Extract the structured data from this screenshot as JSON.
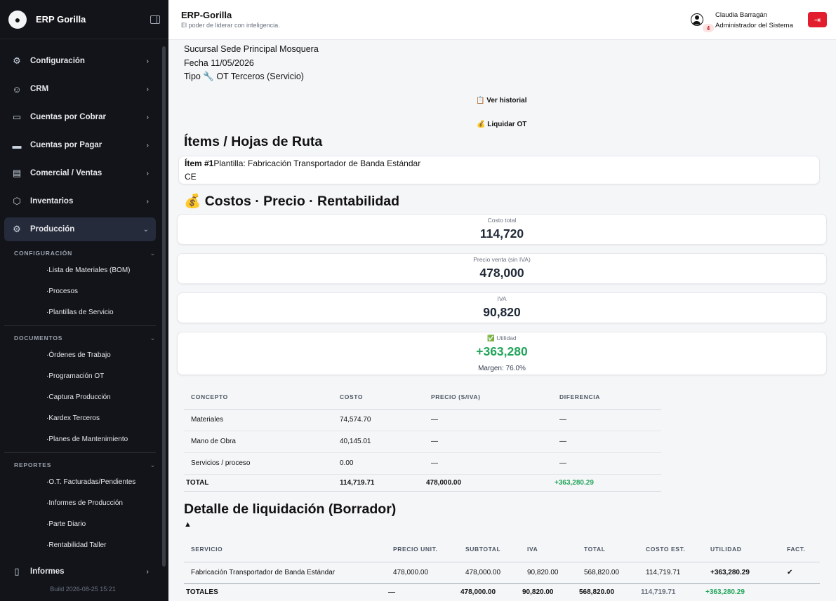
{
  "sidebar": {
    "brand": "ERP Gorilla",
    "menu": [
      {
        "label": "Configuración",
        "icon": "gear-icon"
      },
      {
        "label": "CRM",
        "icon": "crm-icon"
      },
      {
        "label": "Cuentas por Cobrar",
        "icon": "wallet-icon"
      },
      {
        "label": "Cuentas por Pagar",
        "icon": "card-icon"
      },
      {
        "label": "Comercial / Ventas",
        "icon": "receipt-icon"
      },
      {
        "label": "Inventarios",
        "icon": "box-icon"
      },
      {
        "label": "Producción",
        "icon": "cog-icon"
      }
    ],
    "sections": [
      {
        "title": "CONFIGURACIÓN",
        "items": [
          "Lista de Materiales (BOM)",
          "Procesos",
          "Plantillas de Servicio"
        ]
      },
      {
        "title": "DOCUMENTOS",
        "items": [
          "Órdenes de Trabajo",
          "Programación OT",
          "Captura Producción",
          "Kardex Terceros",
          "Planes de Mantenimiento"
        ]
      },
      {
        "title": "REPORTES",
        "items": [
          "O.T. Facturadas/Pendientes",
          "Informes de Producción",
          "Parte Diario",
          "Rentabilidad Taller"
        ]
      }
    ],
    "bottom_item": {
      "label": "Informes",
      "icon": "document-icon"
    },
    "build": "Build 2026-08-25 15:21"
  },
  "header": {
    "title": "ERP-Gorilla",
    "subtitle": "El poder de liderar con inteligencia.",
    "notifications": "4",
    "user_name": "Claudia Barragán",
    "user_role": "Administrador del Sistema"
  },
  "order": {
    "sucursal": "Sucursal Sede Principal Mosquera",
    "fecha": "Fecha 11/05/2026",
    "tipo": "Tipo 🔧 OT Terceros (Servicio)",
    "ver_historial": "📋 Ver historial",
    "liquidar": "💰 Liquidar OT"
  },
  "items_section": {
    "title": "Ítems / Hojas de Ruta",
    "item_number": "Ítem #1",
    "item_text": "Plantilla: Fabricación Transportador de Banda Estándar",
    "item_code": "CE"
  },
  "costs_section": {
    "title": "💰 Costos · Precio · Rentabilidad",
    "kpis": [
      {
        "label": "Costo total",
        "value": "114,720"
      },
      {
        "label": "Precio venta (sin IVA)",
        "value": "478,000"
      },
      {
        "label": "IVA",
        "value": "90,820"
      },
      {
        "label": "✅ Utilidad",
        "value": "+363,280",
        "foot": "Margen: 76.0%"
      }
    ],
    "table": {
      "headers": [
        "CONCEPTO",
        "COSTO",
        "PRECIO (S/IVA)",
        "DIFERENCIA"
      ],
      "rows": [
        [
          "Materiales",
          "74,574.70",
          "—",
          "—"
        ],
        [
          "Mano de Obra",
          "40,145.01",
          "—",
          "—"
        ],
        [
          "Servicios / proceso",
          "0.00",
          "—",
          "—"
        ]
      ],
      "total": [
        "TOTAL",
        "114,719.71",
        "478,000.00",
        "+363,280.29"
      ]
    }
  },
  "liquidation": {
    "title": "Detalle de liquidación (Borrador)",
    "arrow": "▲",
    "headers": [
      "SERVICIO",
      "PRECIO UNIT.",
      "SUBTOTAL",
      "IVA",
      "TOTAL",
      "COSTO EST.",
      "UTILIDAD",
      "FACT."
    ],
    "row": [
      "Fabricación Transportador de Banda Estándar",
      "478,000.00",
      "478,000.00",
      "90,820.00",
      "568,820.00",
      "114,719.71",
      "+363,280.29",
      "✔"
    ],
    "totals": [
      "TOTALES",
      "—",
      "478,000.00",
      "90,820.00",
      "568,820.00",
      "114,719.71",
      "+363,280.29",
      ""
    ]
  }
}
